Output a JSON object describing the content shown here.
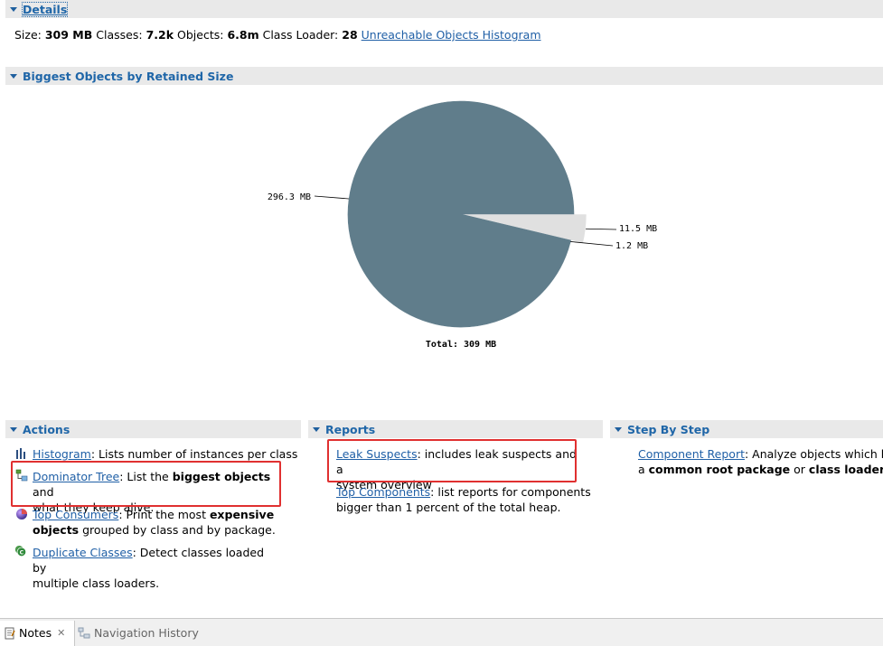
{
  "details": {
    "title": "Details",
    "size_label": "Size:",
    "size_value": "309 MB",
    "classes_label": "Classes:",
    "classes_value": "7.2k",
    "objects_label": "Objects:",
    "objects_value": "6.8m",
    "classloader_label": "Class Loader:",
    "classloader_value": "28",
    "unreachable_link": "Unreachable Objects Histogram"
  },
  "biggest": {
    "title": "Biggest Objects by Retained Size",
    "total_label": "Total: 309 MB"
  },
  "chart_data": {
    "type": "pie",
    "title": "",
    "slices": [
      {
        "label": "296.3 MB",
        "value": 296.3,
        "color": "#607d8b"
      },
      {
        "label": "11.5 MB",
        "value": 11.5,
        "color": "#e0e0e0"
      },
      {
        "label": "1.2 MB",
        "value": 1.2,
        "color": "#607d8b"
      }
    ],
    "total": "Total: 309 MB"
  },
  "actions": {
    "title": "Actions",
    "histogram": {
      "link": "Histogram",
      "desc": ": Lists number of instances per class"
    },
    "dominator": {
      "link": "Dominator Tree",
      "desc1": ": List the ",
      "bold": "biggest objects",
      "desc2": " and",
      "line2": "what they keep alive."
    },
    "top_consumers": {
      "link": "Top Consumers",
      "desc1": ": Print the most ",
      "bold1": "expensive",
      "bold2": "objects",
      "desc2": " grouped by class and by package."
    },
    "duplicate": {
      "link": "Duplicate Classes",
      "desc1": ": Detect classes loaded by",
      "line2": "multiple class loaders."
    }
  },
  "reports": {
    "title": "Reports",
    "leak": {
      "link": "Leak Suspects",
      "desc1": ": includes leak suspects and a",
      "line2": "system overview"
    },
    "top_components": {
      "link": "Top Components",
      "desc1": ": list reports for components",
      "line2": "bigger than 1 percent of the total heap."
    }
  },
  "step": {
    "title": "Step By Step",
    "component": {
      "link": "Component Report",
      "desc1": ": Analyze objects which belo",
      "line2a": "a ",
      "bold1": "common root package",
      "mid": " or ",
      "bold2": "class loader",
      "end": "."
    }
  },
  "bottom": {
    "notes_tab": "Notes",
    "nav_tab": "Navigation History"
  }
}
